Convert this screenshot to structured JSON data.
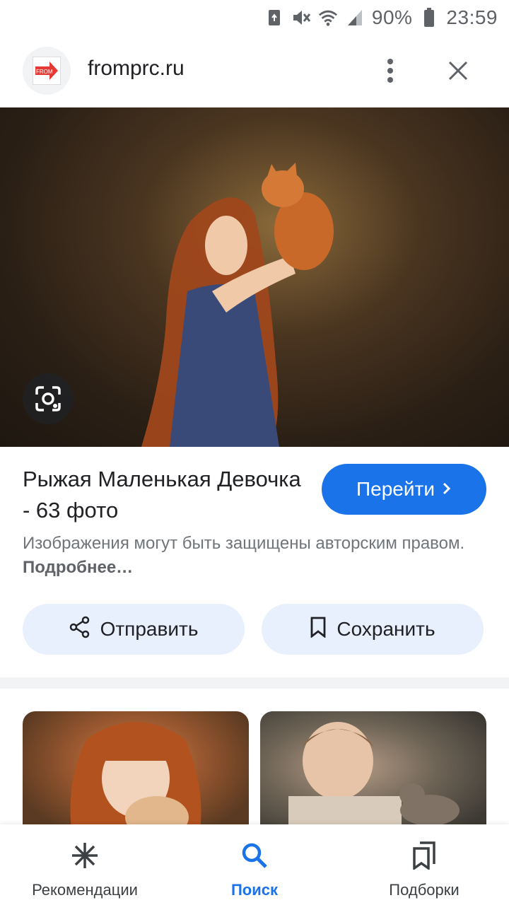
{
  "status_bar": {
    "icons": [
      "recycle-icon",
      "mute-icon",
      "wifi-icon",
      "signal-icon",
      "battery-icon"
    ],
    "battery": "90%",
    "time": "23:59"
  },
  "header": {
    "logo_text": "FROM",
    "site": "fromprc.ru",
    "menu_icon": "more-vert-icon",
    "close_icon": "close-icon"
  },
  "hero": {
    "lens_icon": "google-lens-icon"
  },
  "result": {
    "title": "Рыжая Маленькая Девочка - 63 фото",
    "visit_label": "Перейти",
    "copyright_text": "Изображения могут быть защищены авторским правом.",
    "more_label": "Подробнее…"
  },
  "actions": {
    "share_label": "Отправить",
    "save_label": "Сохранить"
  },
  "bottom_nav": {
    "items": [
      {
        "label": "Рекомендации",
        "icon": "asterisk-icon"
      },
      {
        "label": "Поиск",
        "icon": "search-icon",
        "active": true
      },
      {
        "label": "Подборки",
        "icon": "collections-icon"
      }
    ]
  },
  "colors": {
    "accent": "#1a73e8",
    "chip_bg": "#e8f0fe",
    "secondary_text": "#70757a"
  }
}
